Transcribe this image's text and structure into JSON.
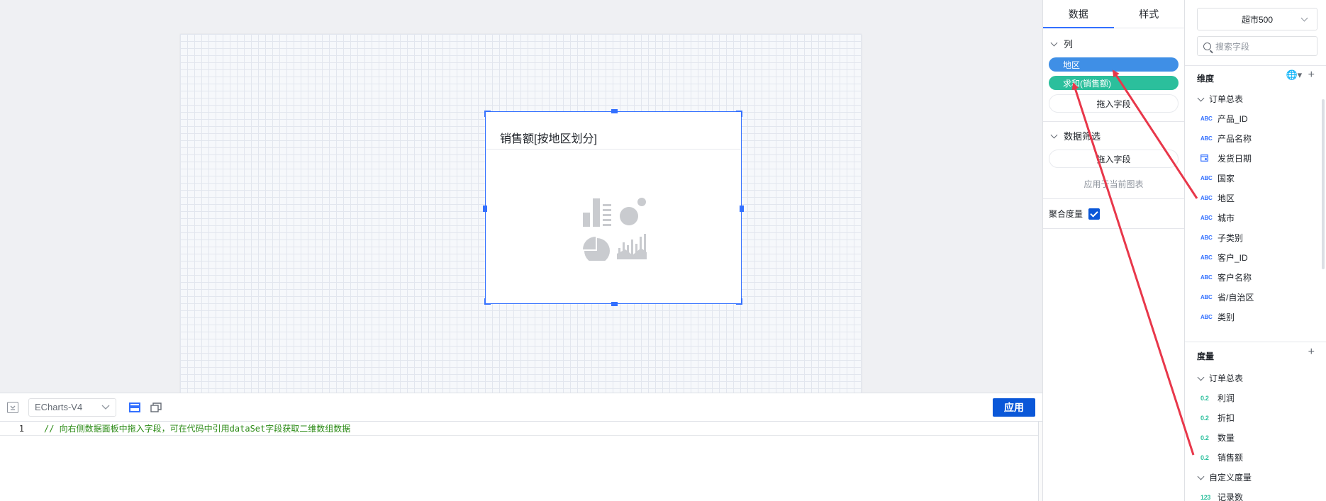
{
  "canvas": {
    "chart_title": "销售额[按地区划分]"
  },
  "editor": {
    "renderer": "ECharts-V4",
    "apply_label": "应用",
    "line_number": "1",
    "code": "// 向右侧数据面板中拖入字段，可在代码中引用dataSet字段获取二维数组数据"
  },
  "prop_panel": {
    "tabs": [
      "数据",
      "样式"
    ],
    "active_tab": "数据",
    "columns": {
      "title": "列",
      "fields": [
        "地区",
        "求和(销售额)"
      ],
      "drop_label": "拖入字段"
    },
    "filter": {
      "title": "数据筛选",
      "drop_label": "拖入字段",
      "hint": "应用于当前图表"
    },
    "aggregate": {
      "label": "聚合度量",
      "checked": true
    }
  },
  "field_panel": {
    "dataset": "超市500",
    "search_placeholder": "搜索字段",
    "dimensions": {
      "title": "维度",
      "table": "订单总表",
      "fields": [
        {
          "type": "ABC",
          "name": "产品_ID"
        },
        {
          "type": "ABC",
          "name": "产品名称"
        },
        {
          "type": "DATE",
          "name": "发货日期"
        },
        {
          "type": "ABC",
          "name": "国家"
        },
        {
          "type": "ABC",
          "name": "地区"
        },
        {
          "type": "ABC",
          "name": "城市"
        },
        {
          "type": "ABC",
          "name": "子类别"
        },
        {
          "type": "ABC",
          "name": "客户_ID"
        },
        {
          "type": "ABC",
          "name": "客户名称"
        },
        {
          "type": "ABC",
          "name": "省/自治区"
        },
        {
          "type": "ABC",
          "name": "类别"
        }
      ]
    },
    "measures": {
      "title": "度量",
      "table": "订单总表",
      "fields": [
        {
          "type": "0.2",
          "name": "利润"
        },
        {
          "type": "0.2",
          "name": "折扣"
        },
        {
          "type": "0.2",
          "name": "数量"
        },
        {
          "type": "0.2",
          "name": "销售额"
        }
      ],
      "custom_title": "自定义度量",
      "custom_fields": [
        {
          "type": "123",
          "name": "记录数"
        }
      ]
    }
  },
  "colors": {
    "accent": "#3370ff",
    "dimension_pill": "#3f8fe6",
    "measure_pill": "#2bbf9c",
    "arrow": "#e8374a",
    "apply_button": "#0a57d8"
  }
}
